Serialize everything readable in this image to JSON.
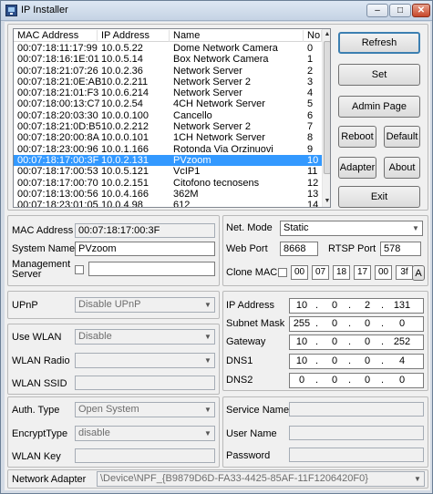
{
  "window": {
    "title": "IP Installer",
    "min": "–",
    "max": "□",
    "close": "✕"
  },
  "device_list": {
    "headers": [
      "MAC Address",
      "IP Address",
      "Name",
      "No"
    ],
    "rows": [
      [
        "00:07:18:11:17:99",
        "10.0.5.22",
        "Dome Network Camera",
        "0"
      ],
      [
        "00:07:18:16:1E:01",
        "10.0.5.14",
        "Box Network Camera",
        "1"
      ],
      [
        "00:07:18:21:07:26",
        "10.0.2.36",
        "Network Server",
        "2"
      ],
      [
        "00:07:18:21:0E:AB",
        "10.0.2.211",
        "Network Server 2",
        "3"
      ],
      [
        "00:07:18:21:01:F3",
        "10.0.6.214",
        "Network Server",
        "4"
      ],
      [
        "00:07:18:00:13:C7",
        "10.0.2.54",
        "4CH Network Server",
        "5"
      ],
      [
        "00:07:18:20:03:30",
        "10.0.0.100",
        "Cancello",
        "6"
      ],
      [
        "00:07:18:21:0D:B5",
        "10.0.2.212",
        "Network Server 2",
        "7"
      ],
      [
        "00:07:18:20:00:8A",
        "10.0.0.101",
        "1CH Network Server",
        "8"
      ],
      [
        "00:07:18:23:00:96",
        "10.0.1.166",
        "Rotonda Via Orzinuovi",
        "9"
      ],
      [
        "00:07:18:17:00:3F",
        "10.0.2.131",
        "PVzoom",
        "10"
      ],
      [
        "00:07:18:17:00:53",
        "10.0.5.121",
        "VcIP1",
        "11"
      ],
      [
        "00:07:18:17:00:70",
        "10.0.2.151",
        "Citofono tecnosens",
        "12"
      ],
      [
        "00:07:18:13:00:56",
        "10.0.4.166",
        "362M",
        "13"
      ],
      [
        "00:07:18:23:01:05",
        "10.0.4.98",
        "612",
        "14"
      ]
    ],
    "selected_index": 10
  },
  "buttons": {
    "refresh": "Refresh",
    "set": "Set",
    "admin_page": "Admin Page",
    "reboot": "Reboot",
    "default": "Default",
    "adapter": "Adapter",
    "about": "About",
    "exit": "Exit"
  },
  "device": {
    "mac_label": "MAC Address",
    "mac_value": "00:07:18:17:00:3F",
    "name_label": "System Name",
    "name_value": "PVzoom",
    "mgmt_label_1": "Management",
    "mgmt_label_2": "Server",
    "mgmt_value": ""
  },
  "net": {
    "mode_label": "Net. Mode",
    "mode_value": "Static",
    "web_port_label": "Web Port",
    "web_port_value": "8668",
    "rtsp_port_label": "RTSP Port",
    "rtsp_port_value": "578",
    "clone_mac_label": "Clone MAC",
    "clone_mac": [
      "00",
      "07",
      "18",
      "17",
      "00",
      "3f"
    ],
    "clone_mac_button": "A"
  },
  "upnp": {
    "label": "UPnP",
    "value": "Disable UPnP"
  },
  "ip_settings": {
    "ip_label": "IP Address",
    "ip": [
      "10",
      "0",
      "2",
      "131"
    ],
    "mask_label": "Subnet Mask",
    "mask": [
      "255",
      "0",
      "0",
      "0"
    ],
    "gw_label": "Gateway",
    "gw": [
      "10",
      "0",
      "0",
      "252"
    ],
    "dns1_label": "DNS1",
    "dns1": [
      "10",
      "0",
      "0",
      "4"
    ],
    "dns2_label": "DNS2",
    "dns2": [
      "0",
      "0",
      "0",
      "0"
    ]
  },
  "wlan": {
    "use_label": "Use WLAN",
    "use_value": "Disable",
    "radio_label": "WLAN Radio",
    "radio_value": "",
    "ssid_label": "WLAN SSID",
    "ssid_value": "",
    "auth_label": "Auth. Type",
    "auth_value": "Open System",
    "encrypt_label": "EncryptType",
    "encrypt_value": "disable",
    "key_label": "WLAN Key",
    "key_value": ""
  },
  "service": {
    "name_label": "Service Name",
    "name_value": "",
    "user_label": "User Name",
    "user_value": "",
    "password_label": "Password",
    "password_value": ""
  },
  "adapter": {
    "label": "Network Adapter",
    "value": "\\Device\\NPF_{B9879D6D-FA33-4425-85AF-11F1206420F0}"
  }
}
